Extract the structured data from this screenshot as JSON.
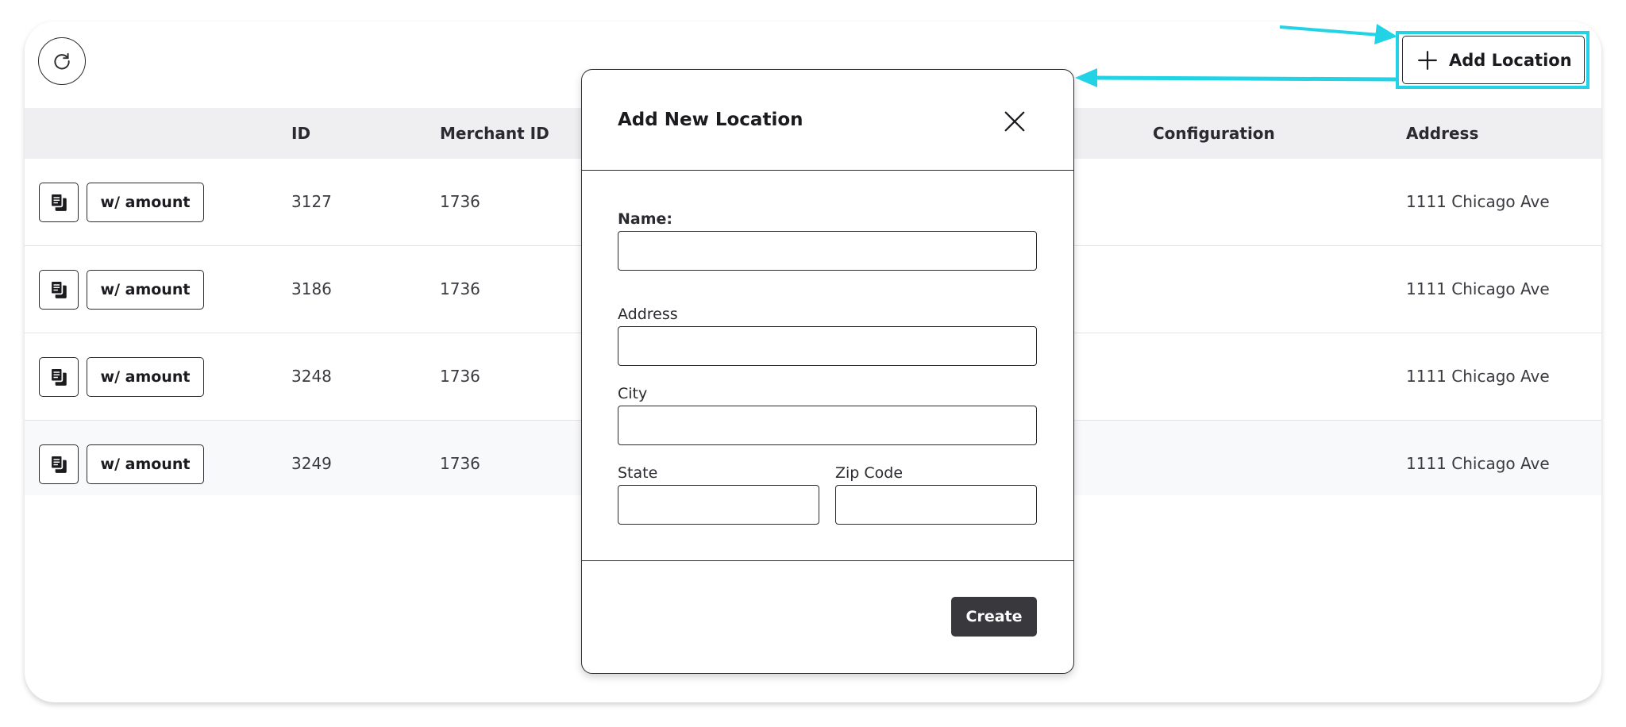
{
  "toolbar": {
    "refresh_icon": "refresh-icon",
    "add_location_label": "Add Location",
    "add_icon": "plus-icon"
  },
  "table": {
    "columns": [
      "ID",
      "Merchant ID",
      "Configuration",
      "Address"
    ],
    "copy_icon": "copy-icon",
    "rows": [
      {
        "action_label": "w/ amount",
        "id": "3127",
        "merchant_id": "1736",
        "address": "1111 Chicago Ave"
      },
      {
        "action_label": "w/ amount",
        "id": "3186",
        "merchant_id": "1736",
        "address": "1111 Chicago Ave"
      },
      {
        "action_label": "w/ amount",
        "id": "3248",
        "merchant_id": "1736",
        "address": "1111 Chicago Ave"
      },
      {
        "action_label": "w/ amount",
        "id": "3249",
        "merchant_id": "1736",
        "address": "1111 Chicago Ave"
      }
    ]
  },
  "modal": {
    "title": "Add New Location",
    "close_icon": "close-icon",
    "fields": {
      "name_label": "Name:",
      "name_value": "",
      "address_label": "Address",
      "address_value": "",
      "city_label": "City",
      "city_value": "",
      "state_label": "State",
      "state_value": "",
      "zip_label": "Zip Code",
      "zip_value": ""
    },
    "create_label": "Create"
  },
  "annotation": {
    "highlight_color": "#22d3e6"
  }
}
